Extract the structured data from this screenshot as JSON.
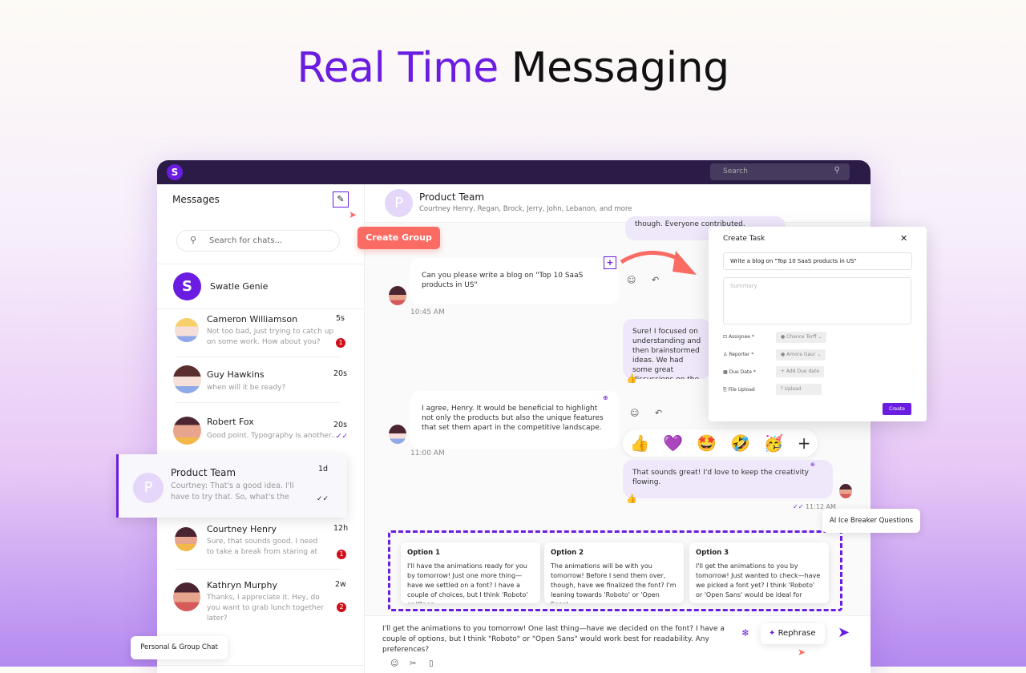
{
  "hero": {
    "title_accent": "Real Time",
    "title_rest": "Messaging"
  },
  "topbar": {
    "logo": "S",
    "search_placeholder": "Search"
  },
  "sidebar": {
    "title": "Messages",
    "search_placeholder": "Search for chats...",
    "genie": "Swatle Genie",
    "chats": [
      {
        "name": "Cameron Williamson",
        "preview": "Not too bad, just trying to catch up on some work. How about you?",
        "time": "5s",
        "badge": "1"
      },
      {
        "name": "Guy Hawkins",
        "preview": "when will it be ready?",
        "time": "20s"
      },
      {
        "name": "Robert Fox",
        "preview": "Good point. Typography is another...",
        "time": "20s",
        "status": "read"
      },
      {
        "name": "Product Team",
        "preview": "Courtney: That's a good idea. I'll have to try that. So, what's the late...",
        "time": "1d",
        "status": "read",
        "avatar": "P",
        "selected": true
      },
      {
        "name": "Courtney Henry",
        "preview": "Sure, that sounds good. I need to take a break from staring at my co...",
        "time": "12h",
        "badge": "1"
      },
      {
        "name": "Kathryn Murphy",
        "preview": "Thanks, I appreciate it. Hey, do you want to grab lunch together later?",
        "time": "2w",
        "badge": "2"
      }
    ]
  },
  "callouts": {
    "create_group": "Create Group",
    "personal_group": "Personal & Group Chat",
    "ice_breaker": "AI Ice Breaker Questions"
  },
  "chat": {
    "avatar": "P",
    "title": "Product Team",
    "members": "Courtney Henry, Regan, Brock, Jerry, John, Lebanon, and more",
    "messages": [
      {
        "text": "though. Everyone contributed.",
        "side": "right"
      },
      {
        "text": "Can you please write a blog on \"Top 10 SaaS products in US\"",
        "side": "left",
        "time": "10:45 AM"
      },
      {
        "text": "Sure! I focused on understanding and then brainstormed ideas. We had some great discussions on the outcome.",
        "side": "right",
        "reaction": "👍"
      },
      {
        "text": "I agree, Henry. It would be beneficial to highlight not only the products but also the unique features that set them apart in the competitive landscape.",
        "side": "left",
        "time": "11:00 AM"
      },
      {
        "text": "That sounds great! I'd love to keep the creativity flowing.",
        "side": "right",
        "reaction": "👍",
        "time": "11:12 AM"
      }
    ],
    "reactions": [
      "👍",
      "💜",
      "🤩",
      "🤣",
      "🥳",
      "+"
    ],
    "options": [
      {
        "title": "Option 1",
        "text": "I'll have the animations ready for you by tomorrow! Just one more thing—have we settled on a font? I have a couple of choices, but I think 'Roboto' or 'Open"
      },
      {
        "title": "Option 2",
        "text": "The animations will be with you tomorrow! Before I send them over, though, have we finalized the font? I'm leaning towards 'Roboto' or 'Open Sans'"
      },
      {
        "title": "Option 3",
        "text": "I'll get the animations to you by tomorrow! Just wanted to check—have we picked a font yet? I think 'Roboto' or 'Open Sans' would be ideal for"
      }
    ],
    "composer_text": "I'll get the animations to you tomorrow! One last thing—have we decided on the font? I have a couple of options, but I think \"Roboto\" or \"Open Sans\" would work best for readability. Any preferences?",
    "rephrase": "Rephrase"
  },
  "task": {
    "title": "Create Task",
    "task_value": "Write a blog on \"Top 10 SaaS products in US\"",
    "summary_placeholder": "Summary",
    "assignee_label": "Assignee *",
    "assignee": "Chance Torff",
    "reporter_label": "Reporter *",
    "reporter": "Amora Gaur",
    "due_label": "Due Date *",
    "due": "+ Add Due date",
    "file_label": "File Upload",
    "upload": "⤒ Upload",
    "create": "Create"
  },
  "colors": {
    "accent": "#6a1de0",
    "coral": "#f96b63",
    "topbar": "#2b1b47",
    "badge": "#d10f1a"
  }
}
